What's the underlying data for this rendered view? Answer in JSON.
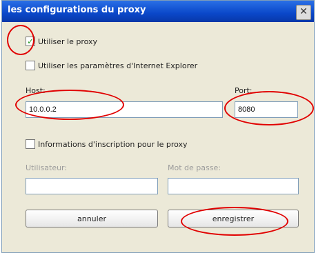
{
  "window": {
    "title": "les configurations du proxy",
    "close_glyph": "✕"
  },
  "options": {
    "use_proxy": {
      "label": "Utiliser le proxy",
      "checked": true
    },
    "use_ie_settings": {
      "label": "Utiliser les paramètres d'Internet Explorer",
      "checked": false
    },
    "proxy_auth": {
      "label": "Informations d'inscription pour le proxy",
      "checked": false
    }
  },
  "host": {
    "label": "Host:",
    "value": "10.0.0.2"
  },
  "port": {
    "label": "Port:",
    "value": "8080"
  },
  "auth": {
    "user_label": "Utilisateur:",
    "user_value": "",
    "password_label": "Mot de passe:",
    "password_value": ""
  },
  "buttons": {
    "cancel": "annuler",
    "save": "enregistrer"
  },
  "annotation_color": "#e10000"
}
